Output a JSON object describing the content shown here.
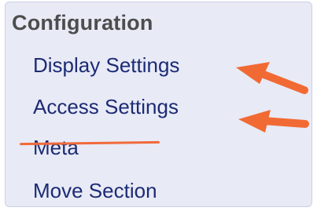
{
  "sidebar": {
    "heading": "Configuration",
    "items": [
      {
        "label": "Display Settings",
        "annotation": "arrow"
      },
      {
        "label": "Access Settings",
        "annotation": "arrow"
      },
      {
        "label": "Meta",
        "annotation": "strikethrough"
      },
      {
        "label": "Move Section"
      }
    ]
  },
  "annotation_color": "#f26a33",
  "icons": [
    "arrow-annotation-icon",
    "strikethrough-annotation"
  ]
}
